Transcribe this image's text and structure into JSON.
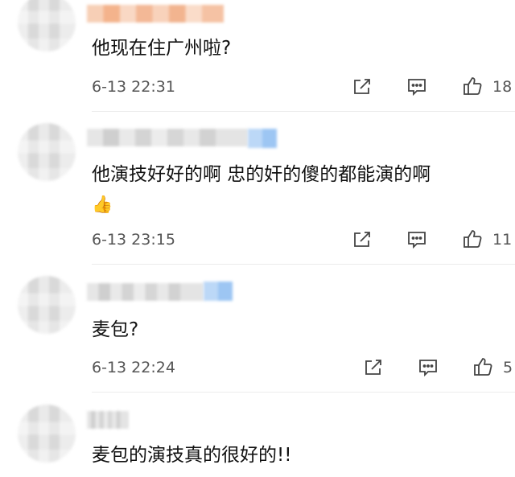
{
  "comments": [
    {
      "text": "他现在住广州啦?",
      "time": "6-13 22:31",
      "likes": "18",
      "icons": {
        "forward": "share-edit-icon",
        "reply": "comment-icon",
        "like": "thumbs-up-icon"
      }
    },
    {
      "text": "他演技好好的啊 忠的奸的傻的都能演的啊",
      "emoji": "👍",
      "time": "6-13 23:15",
      "likes": "11",
      "icons": {
        "forward": "share-edit-icon",
        "reply": "comment-icon",
        "like": "thumbs-up-icon"
      }
    },
    {
      "text": "麦包?",
      "time": "6-13 22:24",
      "likes": "5",
      "icons": {
        "forward": "share-edit-icon",
        "reply": "comment-icon",
        "like": "thumbs-up-icon"
      }
    },
    {
      "text": "麦包的演技真的很好的!!"
    }
  ],
  "colors": {
    "text": "#111111",
    "meta": "#555555",
    "icon": "#444444",
    "divider": "#ececec"
  }
}
